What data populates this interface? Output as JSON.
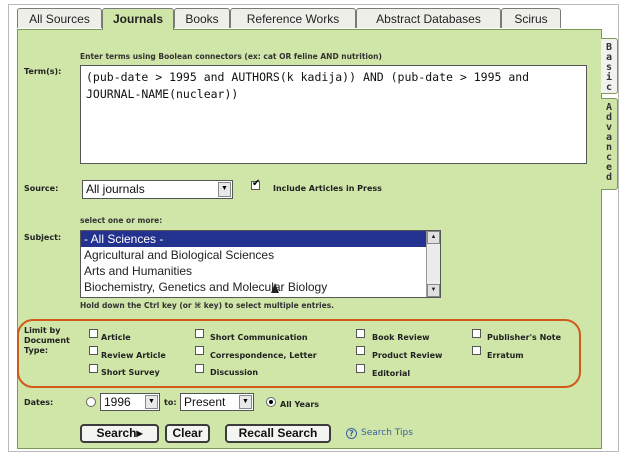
{
  "tabs": [
    {
      "label": "All Sources"
    },
    {
      "label": "Journals"
    },
    {
      "label": "Books"
    },
    {
      "label": "Reference Works"
    },
    {
      "label": "Abstract Databases"
    },
    {
      "label": "Scirus"
    }
  ],
  "side_tabs": {
    "basic": "Basic",
    "advanced": "Advanced"
  },
  "terms": {
    "label": "Term(s):",
    "hint": "Enter terms using Boolean connectors (ex: cat OR feline AND nutrition)",
    "value": "(pub-date > 1995 and AUTHORS(k kadija)) AND (pub-date > 1995 and JOURNAL-NAME(nuclear))"
  },
  "source": {
    "label": "Source:",
    "selected": "All journals",
    "include_in_press_label": "Include Articles in Press",
    "include_in_press_checked": true
  },
  "subject": {
    "label": "Subject:",
    "hint": "select one or more:",
    "options": [
      {
        "label": "- All Sciences -",
        "selected": true
      },
      {
        "label": "Agricultural and Biological Sciences",
        "selected": false
      },
      {
        "label": "Arts and Humanities",
        "selected": false
      },
      {
        "label": "Biochemistry, Genetics and Molecular Biology",
        "selected": false
      }
    ],
    "footnote": "Hold down the Ctrl key (or ⌘ key) to select multiple entries."
  },
  "doc_types": {
    "label": "Limit by Document Type:",
    "items": [
      {
        "label": "Article",
        "checked": false
      },
      {
        "label": "Short Communication",
        "checked": false
      },
      {
        "label": "Book Review",
        "checked": false
      },
      {
        "label": "Publisher's Note",
        "checked": false
      },
      {
        "label": "Review Article",
        "checked": false
      },
      {
        "label": "Correspondence, Letter",
        "checked": false
      },
      {
        "label": "Product Review",
        "checked": false
      },
      {
        "label": "Erratum",
        "checked": false
      },
      {
        "label": "Short Survey",
        "checked": false
      },
      {
        "label": "Discussion",
        "checked": false
      },
      {
        "label": "Editorial",
        "checked": false
      }
    ]
  },
  "dates": {
    "label": "Dates:",
    "from": "1996",
    "to_label": "to:",
    "to": "Present",
    "all_years_label": "All Years",
    "all_years_selected": true,
    "range_selected": false
  },
  "buttons": {
    "search": "Search▸",
    "clear": "Clear",
    "recall": "Recall Search"
  },
  "help_link": "Search Tips",
  "colors": {
    "panel": "#cfe6a8",
    "highlight_ring": "#d05a1c",
    "link": "#3a5fa0"
  }
}
